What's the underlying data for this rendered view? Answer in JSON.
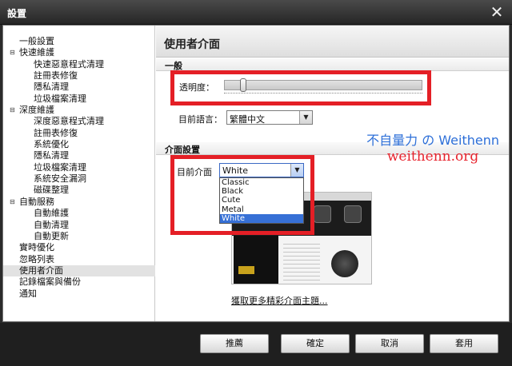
{
  "window": {
    "title": "設置",
    "close_glyph": "✕"
  },
  "sidebar": {
    "items": [
      {
        "label": "一般設置",
        "indent": 0,
        "expander": ""
      },
      {
        "label": "快速維護",
        "indent": 0,
        "expander": "⊟"
      },
      {
        "label": "快速惡意程式清理",
        "indent": 2,
        "expander": ""
      },
      {
        "label": "註冊表修復",
        "indent": 2,
        "expander": ""
      },
      {
        "label": "隱私清理",
        "indent": 2,
        "expander": ""
      },
      {
        "label": "垃圾檔案清理",
        "indent": 2,
        "expander": ""
      },
      {
        "label": "深度維護",
        "indent": 0,
        "expander": "⊟"
      },
      {
        "label": "深度惡意程式清理",
        "indent": 2,
        "expander": ""
      },
      {
        "label": "註冊表修復",
        "indent": 2,
        "expander": ""
      },
      {
        "label": "系統優化",
        "indent": 2,
        "expander": ""
      },
      {
        "label": "隱私清理",
        "indent": 2,
        "expander": ""
      },
      {
        "label": "垃圾檔案清理",
        "indent": 2,
        "expander": ""
      },
      {
        "label": "系統安全漏洞",
        "indent": 2,
        "expander": ""
      },
      {
        "label": "磁碟整理",
        "indent": 2,
        "expander": ""
      },
      {
        "label": "自動服務",
        "indent": 0,
        "expander": "⊟"
      },
      {
        "label": "自動維護",
        "indent": 2,
        "expander": ""
      },
      {
        "label": "自動清理",
        "indent": 2,
        "expander": ""
      },
      {
        "label": "自動更新",
        "indent": 2,
        "expander": ""
      },
      {
        "label": "實時優化",
        "indent": 0,
        "expander": ""
      },
      {
        "label": "忽略列表",
        "indent": 0,
        "expander": ""
      },
      {
        "label": "使用者介面",
        "indent": 0,
        "expander": "",
        "selected": true
      },
      {
        "label": "記錄檔案與備份",
        "indent": 0,
        "expander": ""
      },
      {
        "label": "通知",
        "indent": 0,
        "expander": ""
      }
    ]
  },
  "content": {
    "page_title": "使用者介面",
    "general": {
      "section_title": "一般",
      "transparency_label": "透明度：",
      "transparency_value": 0.08,
      "language_label": "目前語言：",
      "language_value": "繁體中文"
    },
    "skin": {
      "section_title": "介面設置",
      "current_skin_label": "目前介面",
      "current_skin_value": "White",
      "options": [
        "Classic",
        "Black",
        "Cute",
        "Metal",
        "White"
      ],
      "selected_option": "White",
      "more_themes_link": "獲取更多精彩介面主題..."
    },
    "watermark": {
      "line1": "不自量力 の Weithenn",
      "line2": "weithenn.org"
    }
  },
  "footer": {
    "recommend_label": "推薦",
    "ok_label": "確定",
    "cancel_label": "取消",
    "apply_label": "套用"
  },
  "colors": {
    "highlight": "#e41f26",
    "selection": "#3670d6",
    "watermark_blue": "#2d6fd8",
    "watermark_red": "#e8232d"
  }
}
